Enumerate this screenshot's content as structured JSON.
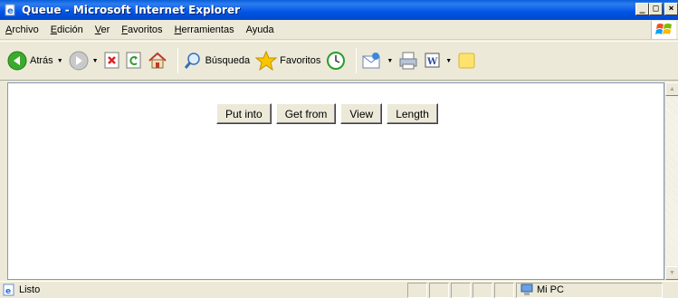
{
  "window": {
    "title": "Queue - Microsoft Internet Explorer",
    "minimize": "_",
    "maximize": "□",
    "close": "×"
  },
  "menu": {
    "items": [
      {
        "first": "A",
        "rest": "rchivo"
      },
      {
        "first": "E",
        "rest": "dición"
      },
      {
        "first": "V",
        "rest": "er"
      },
      {
        "first": "F",
        "rest": "avoritos"
      },
      {
        "first": "H",
        "rest": "erramientas"
      },
      {
        "first": "",
        "rest": "Ayuda"
      }
    ]
  },
  "toolbar": {
    "back_label": "Atrás",
    "search_label": "Búsqueda",
    "favorites_label": "Favoritos"
  },
  "page": {
    "buttons": [
      "Put into",
      "Get from",
      "View",
      "Length"
    ]
  },
  "status": {
    "text": "Listo",
    "zone": "Mi PC"
  },
  "colors": {
    "titlebar": "#0055e5",
    "window_chrome": "#ece9d8",
    "content_bg": "#ffffff"
  }
}
